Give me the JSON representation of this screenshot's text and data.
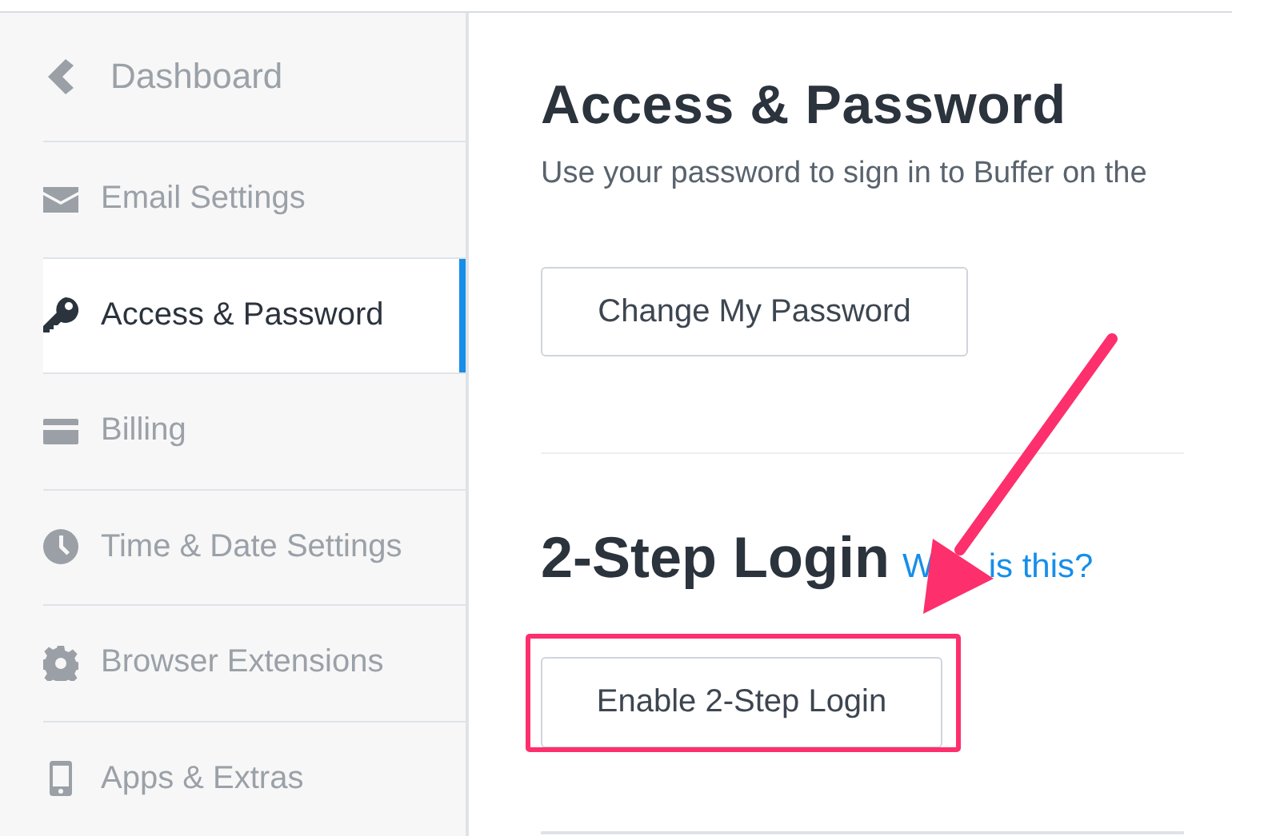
{
  "sidebar": {
    "back": {
      "label": "Dashboard"
    },
    "items": [
      {
        "label": "Email Settings",
        "selected": false
      },
      {
        "label": "Access & Password",
        "selected": true
      },
      {
        "label": "Billing",
        "selected": false
      },
      {
        "label": "Time & Date Settings",
        "selected": false
      },
      {
        "label": "Browser Extensions",
        "selected": false
      },
      {
        "label": "Apps & Extras",
        "selected": false
      }
    ]
  },
  "content": {
    "title": "Access & Password",
    "description": "Use your password to sign in to Buffer on the",
    "change_button": "Change My Password",
    "two_step": {
      "heading": "2-Step Login",
      "link": {
        "parts": [
          "W",
          "is this?"
        ]
      },
      "button": "Enable 2-Step Login"
    }
  },
  "annotations": {
    "callout_arrow": true,
    "highlight_frame": true
  }
}
